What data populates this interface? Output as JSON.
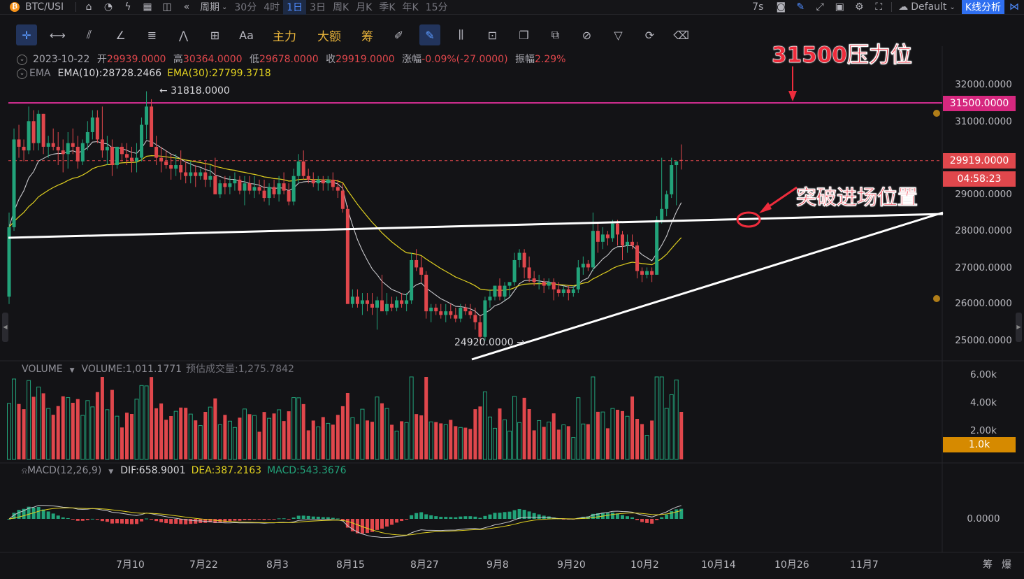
{
  "topbar": {
    "symbol": "BTC/USI",
    "period_label": "周期",
    "intervals": [
      "30分",
      "4时",
      "1日",
      "3日",
      "周K",
      "月K",
      "季K",
      "年K",
      "15分"
    ],
    "active_interval": "1日",
    "refresh": "7s",
    "theme": "Default",
    "k_analysis": "K线分析"
  },
  "toolbar": {
    "main_force": "主力",
    "big_amount": "大额",
    "chips": "筹",
    "font_tool": "Aa"
  },
  "ohlc": {
    "date": "2023-10-22",
    "open_label": "开",
    "open": "29939.0000",
    "high_label": "高",
    "high": "30364.0000",
    "low_label": "低",
    "low": "29678.0000",
    "close_label": "收",
    "close": "29919.0000",
    "change_label": "涨幅",
    "change": "-0.09%(-27.0000)",
    "amp_label": "振幅",
    "amp": "2.29%"
  },
  "ema": {
    "name": "EMA",
    "ema10": "EMA(10):28728.2466",
    "ema30": "EMA(30):27799.3718"
  },
  "volume": {
    "name": "VOLUME",
    "value": "VOLUME:1,011.1771",
    "estimate": "预估成交量:1,275.7842",
    "axis": [
      "6.00k",
      "4.00k",
      "2.00k"
    ],
    "current_tag": "1.0k"
  },
  "macd": {
    "name": "MACD(12,26,9)",
    "dif": "DIF:658.9001",
    "dea": "DEA:387.2163",
    "macd": "MACD:543.3676",
    "zero": "0.0000"
  },
  "price_axis": [
    "32000.0000",
    "31000.0000",
    "29000.0000",
    "28000.0000",
    "27000.0000",
    "26000.0000",
    "25000.0000"
  ],
  "price_tags": {
    "resistance": "31500.0000",
    "last": "29919.0000",
    "countdown": "04:58:23"
  },
  "markers": {
    "high": "← 31818.0000",
    "low": "24920.0000 →"
  },
  "dates": [
    "7月10",
    "7月22",
    "8月3",
    "8月15",
    "8月27",
    "9月8",
    "9月20",
    "10月2",
    "10月14",
    "10月26",
    "11月7"
  ],
  "bottom_right": [
    "筹",
    "爆"
  ],
  "annotations": {
    "resistance": "31500压力位",
    "breakout": "突破进场位置"
  },
  "colors": {
    "up": "#22a37a",
    "down": "#e0474c",
    "ema10": "#c8c8cc",
    "ema30": "#e0d020",
    "resistance_line": "#e0309a",
    "accent": "#4f8cff",
    "annotation": "#ee2c3c"
  },
  "chart_data": {
    "type": "candlestick",
    "ylim": [
      24700,
      32400
    ],
    "resistance": 31500,
    "candles": [
      [
        26200,
        28500,
        26000,
        28100
      ],
      [
        28100,
        30800,
        28000,
        30500
      ],
      [
        30500,
        30900,
        30000,
        30300
      ],
      [
        30300,
        30500,
        29900,
        30200
      ],
      [
        30200,
        31400,
        30100,
        31000
      ],
      [
        31000,
        31300,
        30200,
        30400
      ],
      [
        30400,
        31300,
        30200,
        31200
      ],
      [
        31200,
        31200,
        30100,
        30300
      ],
      [
        30300,
        30600,
        30000,
        30400
      ],
      [
        30400,
        30800,
        30200,
        30300
      ],
      [
        30300,
        30700,
        29800,
        30200
      ],
      [
        30200,
        30500,
        29600,
        30100
      ],
      [
        30100,
        30700,
        29700,
        30400
      ],
      [
        30400,
        30800,
        30100,
        30300
      ],
      [
        30300,
        30600,
        29700,
        29900
      ],
      [
        29900,
        30500,
        29800,
        30400
      ],
      [
        30400,
        31000,
        30200,
        30700
      ],
      [
        30700,
        31300,
        30500,
        31100
      ],
      [
        31100,
        31300,
        30400,
        30500
      ],
      [
        30500,
        31400,
        30000,
        30200
      ],
      [
        30200,
        30600,
        29800,
        30300
      ],
      [
        30300,
        30500,
        29500,
        29800
      ],
      [
        29800,
        30300,
        29700,
        30300
      ],
      [
        30300,
        30400,
        29900,
        30100
      ],
      [
        30100,
        30400,
        29800,
        30000
      ],
      [
        30000,
        30300,
        29600,
        29900
      ],
      [
        29900,
        30400,
        29600,
        30000
      ],
      [
        30000,
        31100,
        29900,
        30900
      ],
      [
        30900,
        31818,
        30500,
        31400
      ],
      [
        31400,
        31600,
        30300,
        30300
      ],
      [
        30300,
        30600,
        29800,
        30000
      ],
      [
        30000,
        30300,
        29600,
        29900
      ],
      [
        29900,
        30200,
        29700,
        29800
      ],
      [
        29800,
        30100,
        29400,
        29700
      ],
      [
        29700,
        30100,
        29500,
        29800
      ],
      [
        29800,
        30200,
        29400,
        29600
      ],
      [
        29600,
        29900,
        29300,
        29500
      ],
      [
        29500,
        29900,
        29300,
        29600
      ],
      [
        29600,
        29800,
        29200,
        29500
      ],
      [
        29500,
        29700,
        29400,
        29600
      ],
      [
        29600,
        29900,
        29200,
        29400
      ],
      [
        29400,
        29800,
        29200,
        29500
      ],
      [
        29500,
        30000,
        29100,
        29000
      ],
      [
        29000,
        29400,
        28900,
        29300
      ],
      [
        29300,
        29500,
        29000,
        29200
      ],
      [
        29200,
        29500,
        29000,
        29300
      ],
      [
        29300,
        29600,
        29100,
        29400
      ],
      [
        29400,
        29500,
        29000,
        29100
      ],
      [
        29100,
        29500,
        28700,
        29300
      ],
      [
        29300,
        29500,
        29000,
        29100
      ],
      [
        29100,
        29500,
        28900,
        29200
      ],
      [
        29200,
        29400,
        29000,
        29100
      ],
      [
        29100,
        29400,
        28800,
        28900
      ],
      [
        28900,
        29300,
        28700,
        29200
      ],
      [
        29200,
        29400,
        28900,
        29000
      ],
      [
        29000,
        29500,
        28800,
        29300
      ],
      [
        29300,
        29600,
        29000,
        29100
      ],
      [
        29100,
        29300,
        28700,
        28800
      ],
      [
        28800,
        29700,
        28700,
        29500
      ],
      [
        29500,
        30100,
        29300,
        29900
      ],
      [
        29900,
        30200,
        29400,
        29500
      ],
      [
        29500,
        29700,
        29300,
        29400
      ],
      [
        29400,
        29600,
        29200,
        29300
      ],
      [
        29300,
        29500,
        29100,
        29400
      ],
      [
        29400,
        29500,
        29100,
        29300
      ],
      [
        29300,
        29500,
        29100,
        29400
      ],
      [
        29400,
        29600,
        29100,
        29200
      ],
      [
        29200,
        29400,
        28900,
        29100
      ],
      [
        29100,
        29300,
        28500,
        28600
      ],
      [
        28600,
        28700,
        26200,
        26000
      ],
      [
        26000,
        26400,
        25900,
        26200
      ],
      [
        26200,
        26400,
        25900,
        26000
      ],
      [
        26000,
        26300,
        25700,
        26100
      ],
      [
        26100,
        26300,
        25800,
        26000
      ],
      [
        26000,
        26300,
        25700,
        25900
      ],
      [
        25900,
        26200,
        25300,
        26100
      ],
      [
        26100,
        26800,
        25900,
        25800
      ],
      [
        25800,
        26300,
        25700,
        26000
      ],
      [
        26000,
        26200,
        25800,
        25900
      ],
      [
        25900,
        26200,
        25800,
        26100
      ],
      [
        26100,
        26300,
        25900,
        26000
      ],
      [
        26000,
        26300,
        25800,
        26100
      ],
      [
        26100,
        27400,
        26000,
        27200
      ],
      [
        27200,
        27500,
        26900,
        27000
      ],
      [
        27000,
        27300,
        26600,
        26800
      ],
      [
        26800,
        26900,
        25600,
        25800
      ],
      [
        25800,
        26000,
        25500,
        25900
      ],
      [
        25900,
        26000,
        25700,
        25800
      ],
      [
        25800,
        26000,
        25600,
        25700
      ],
      [
        25700,
        26000,
        25500,
        25800
      ],
      [
        25800,
        26000,
        25600,
        25700
      ],
      [
        25700,
        25900,
        25500,
        25600
      ],
      [
        25600,
        26000,
        25500,
        25900
      ],
      [
        25900,
        26000,
        25700,
        25800
      ],
      [
        25800,
        26000,
        25600,
        25700
      ],
      [
        25700,
        25900,
        25300,
        25500
      ],
      [
        25500,
        25700,
        24920,
        25100
      ],
      [
        25100,
        26200,
        25000,
        26100
      ],
      [
        26100,
        26400,
        25900,
        26200
      ],
      [
        26200,
        26500,
        26100,
        26500
      ],
      [
        26500,
        26700,
        26100,
        26200
      ],
      [
        26200,
        26600,
        26100,
        26500
      ],
      [
        26500,
        26600,
        26200,
        26600
      ],
      [
        26600,
        27400,
        26500,
        27200
      ],
      [
        27200,
        27500,
        27000,
        27400
      ],
      [
        27400,
        27500,
        26700,
        27000
      ],
      [
        27000,
        27300,
        26600,
        26700
      ],
      [
        26700,
        26900,
        26500,
        26600
      ],
      [
        26600,
        26800,
        26400,
        26600
      ],
      [
        26600,
        26700,
        26300,
        26500
      ],
      [
        26500,
        26700,
        26400,
        26600
      ],
      [
        26600,
        26700,
        26100,
        26400
      ],
      [
        26400,
        26600,
        26200,
        26300
      ],
      [
        26300,
        26500,
        26200,
        26400
      ],
      [
        26400,
        26500,
        26100,
        26300
      ],
      [
        26300,
        26500,
        26200,
        26400
      ],
      [
        26400,
        27200,
        26300,
        27000
      ],
      [
        27000,
        27300,
        26800,
        27100
      ],
      [
        27100,
        27200,
        26900,
        27000
      ],
      [
        27000,
        28500,
        26900,
        28000
      ],
      [
        28000,
        28200,
        27400,
        27700
      ],
      [
        27700,
        28100,
        27500,
        27900
      ],
      [
        27900,
        28000,
        27600,
        27800
      ],
      [
        27800,
        28300,
        27700,
        28200
      ],
      [
        28200,
        28300,
        27600,
        27900
      ],
      [
        27900,
        28000,
        27200,
        27600
      ],
      [
        27600,
        27900,
        27400,
        27700
      ],
      [
        27700,
        27900,
        27500,
        27600
      ],
      [
        27600,
        27700,
        26700,
        26900
      ],
      [
        26900,
        27000,
        26600,
        26800
      ],
      [
        26800,
        27000,
        26700,
        26900
      ],
      [
        26900,
        27000,
        26600,
        26800
      ],
      [
        26800,
        28400,
        26800,
        28300
      ],
      [
        28300,
        30000,
        28200,
        28600
      ],
      [
        28600,
        29100,
        28400,
        29000
      ],
      [
        29000,
        30000,
        28900,
        29800
      ],
      [
        29800,
        29900,
        28700,
        29900
      ],
      [
        29939,
        30364,
        29678,
        29919
      ]
    ]
  }
}
